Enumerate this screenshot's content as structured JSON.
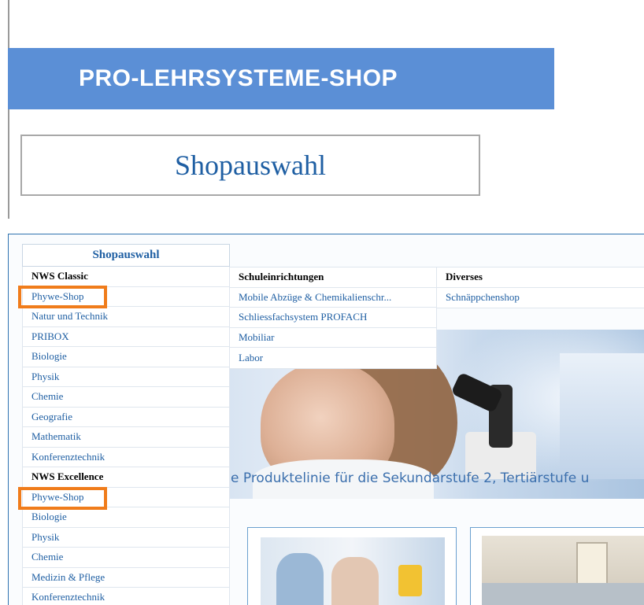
{
  "banner": {
    "title": "PRO-LEHRSYSTEME-SHOP"
  },
  "shop_box": {
    "title": "Shopauswahl"
  },
  "menu": {
    "header": "Shopauswahl",
    "items": [
      {
        "label": "NWS Classic",
        "type": "heading"
      },
      {
        "label": "Phywe-Shop",
        "type": "link",
        "highlighted": true
      },
      {
        "label": "Natur und Technik",
        "type": "link"
      },
      {
        "label": "PRIBOX",
        "type": "link"
      },
      {
        "label": "Biologie",
        "type": "link"
      },
      {
        "label": "Physik",
        "type": "link"
      },
      {
        "label": "Chemie",
        "type": "link"
      },
      {
        "label": "Geografie",
        "type": "link"
      },
      {
        "label": "Mathematik",
        "type": "link"
      },
      {
        "label": "Konferenztechnik",
        "type": "link"
      },
      {
        "label": "NWS Excellence",
        "type": "heading"
      },
      {
        "label": "Phywe-Shop",
        "type": "link",
        "highlighted": true
      },
      {
        "label": "Biologie",
        "type": "link"
      },
      {
        "label": "Physik",
        "type": "link"
      },
      {
        "label": "Chemie",
        "type": "link"
      },
      {
        "label": "Medizin & Pflege",
        "type": "link"
      },
      {
        "label": "Konferenztechnik",
        "type": "link"
      }
    ]
  },
  "columns": [
    {
      "heading": "Schuleinrichtungen",
      "items": [
        "Mobile Abzüge & Chemikalienschr...",
        "Schliessfachsystem PROFACH",
        "Mobiliar",
        "Labor"
      ]
    },
    {
      "heading": "Diverses",
      "items": [
        "Schnäppchenshop"
      ]
    }
  ],
  "hero": {
    "tagline": "e Produktelinie für  die Sekundarstufe 2, Tertiärstufe u"
  },
  "colors": {
    "banner": "#5b8fd6",
    "link": "#1f5fa3",
    "highlight": "#f07c1b",
    "panel_border": "#2f73b0"
  }
}
